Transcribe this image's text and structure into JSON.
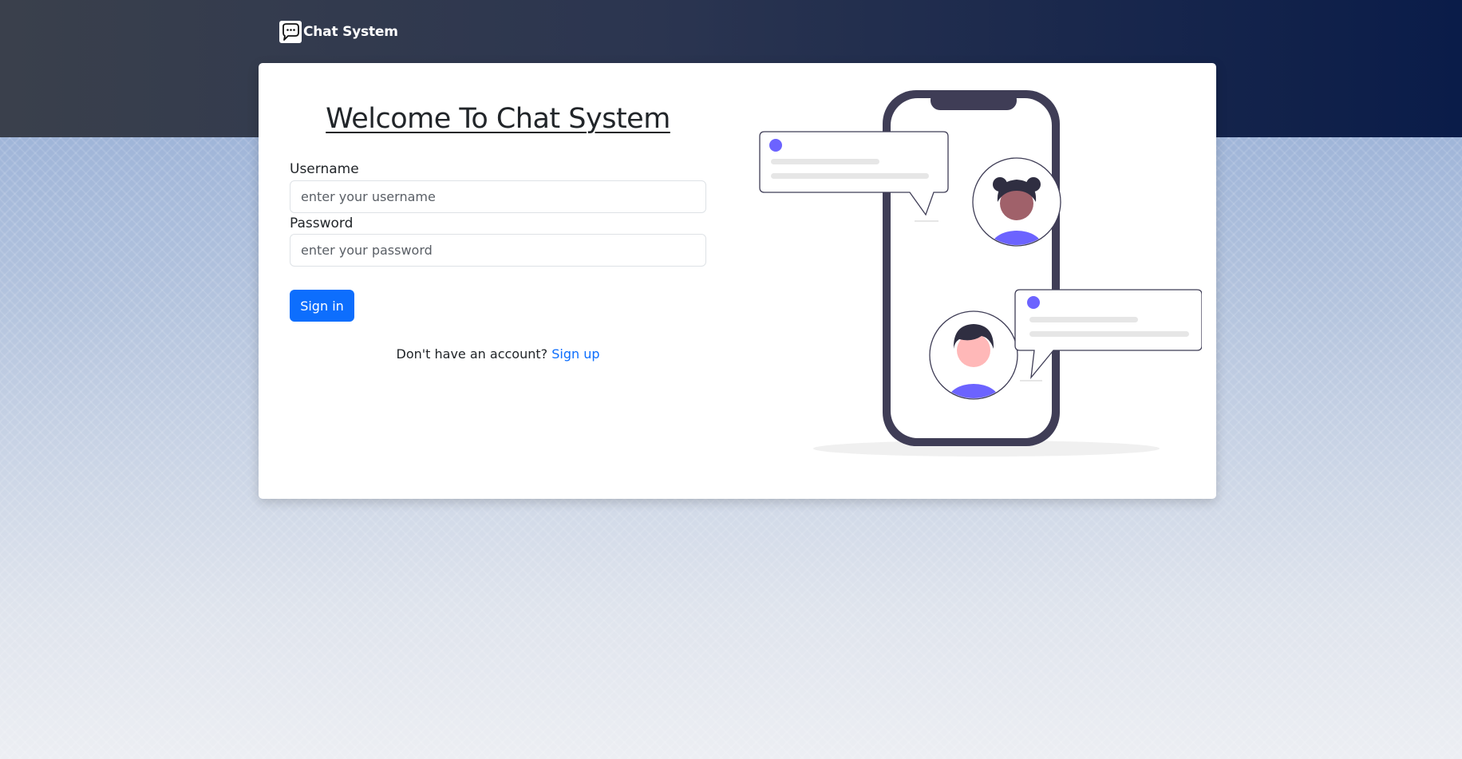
{
  "navbar": {
    "brand_name": "Chat System",
    "brand_icon": "chat-bubble-icon"
  },
  "login_form": {
    "title": "Welcome To Chat System",
    "username_label": "Username",
    "username_placeholder": "enter your username",
    "username_value": "",
    "password_label": "Password",
    "password_placeholder": "enter your password",
    "password_value": "",
    "submit_label": "Sign in",
    "signup_prompt": "Don't have an account?",
    "signup_link": "Sign up"
  },
  "illustration": {
    "name": "phone-chat-illustration"
  },
  "colors": {
    "primary": "#0d6efd",
    "accent_purple": "#6c63ff",
    "phone_frame": "#3f3d56",
    "navbar_dark": "#0a1c49"
  }
}
